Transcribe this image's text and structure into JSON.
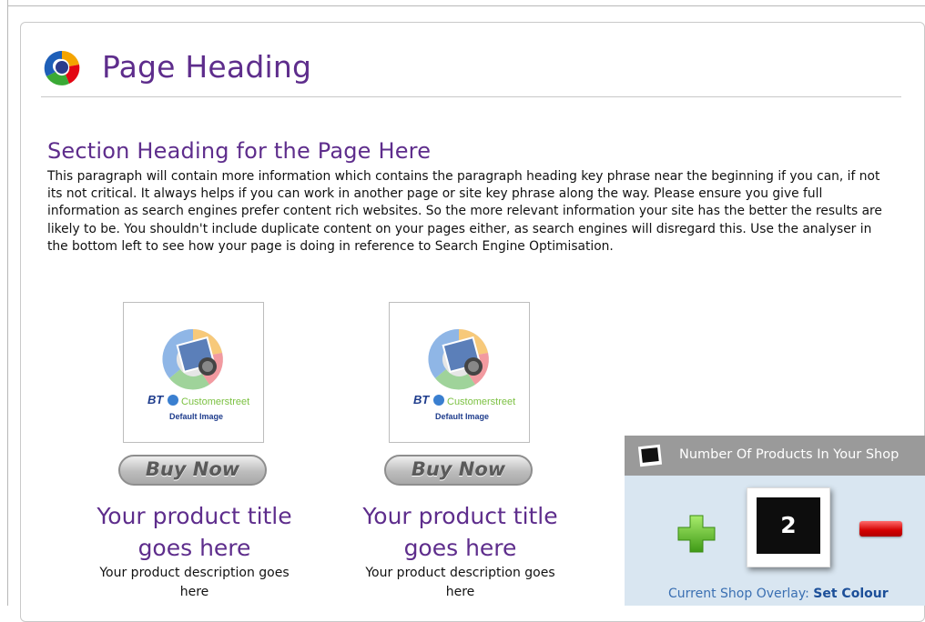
{
  "page": {
    "heading": "Page Heading",
    "section_heading": "Section Heading for the Page Here",
    "paragraph": "This paragraph will contain more information which contains the paragraph heading key phrase near the beginning if you can, if not its not critical. It always helps if you can work in another page or site key phrase along the way. Please ensure you give full information as search engines prefer content rich websites. So the more relevant information your site has the better the results are likely to be. You shouldn't include duplicate content on your pages either, as search engines will disregard this. Use the analyser in the bottom left to see how your page is doing in reference to Search Engine Optimisation."
  },
  "products": [
    {
      "image_brand": "BT",
      "image_caption": "Customerstreet",
      "image_label": "Default Image",
      "buy_label": "Buy Now",
      "title": "Your product title goes here",
      "description": "Your product description goes here"
    },
    {
      "image_brand": "BT",
      "image_caption": "Customerstreet",
      "image_label": "Default Image",
      "buy_label": "Buy Now",
      "title": "Your product title goes here",
      "description": "Your product description goes here"
    }
  ],
  "widget": {
    "title": "Number Of Products In Your Shop",
    "count": "2",
    "overlay_label": "Current Shop Overlay:",
    "overlay_action": "Set Colour",
    "icons": [
      "monitor-icon",
      "plus-icon",
      "minus-icon"
    ]
  },
  "colors": {
    "heading_purple": "#5e2d8c",
    "widget_bg": "#d9e6f1",
    "widget_header": "#9a9a9a",
    "link_blue": "#1c4f99"
  }
}
